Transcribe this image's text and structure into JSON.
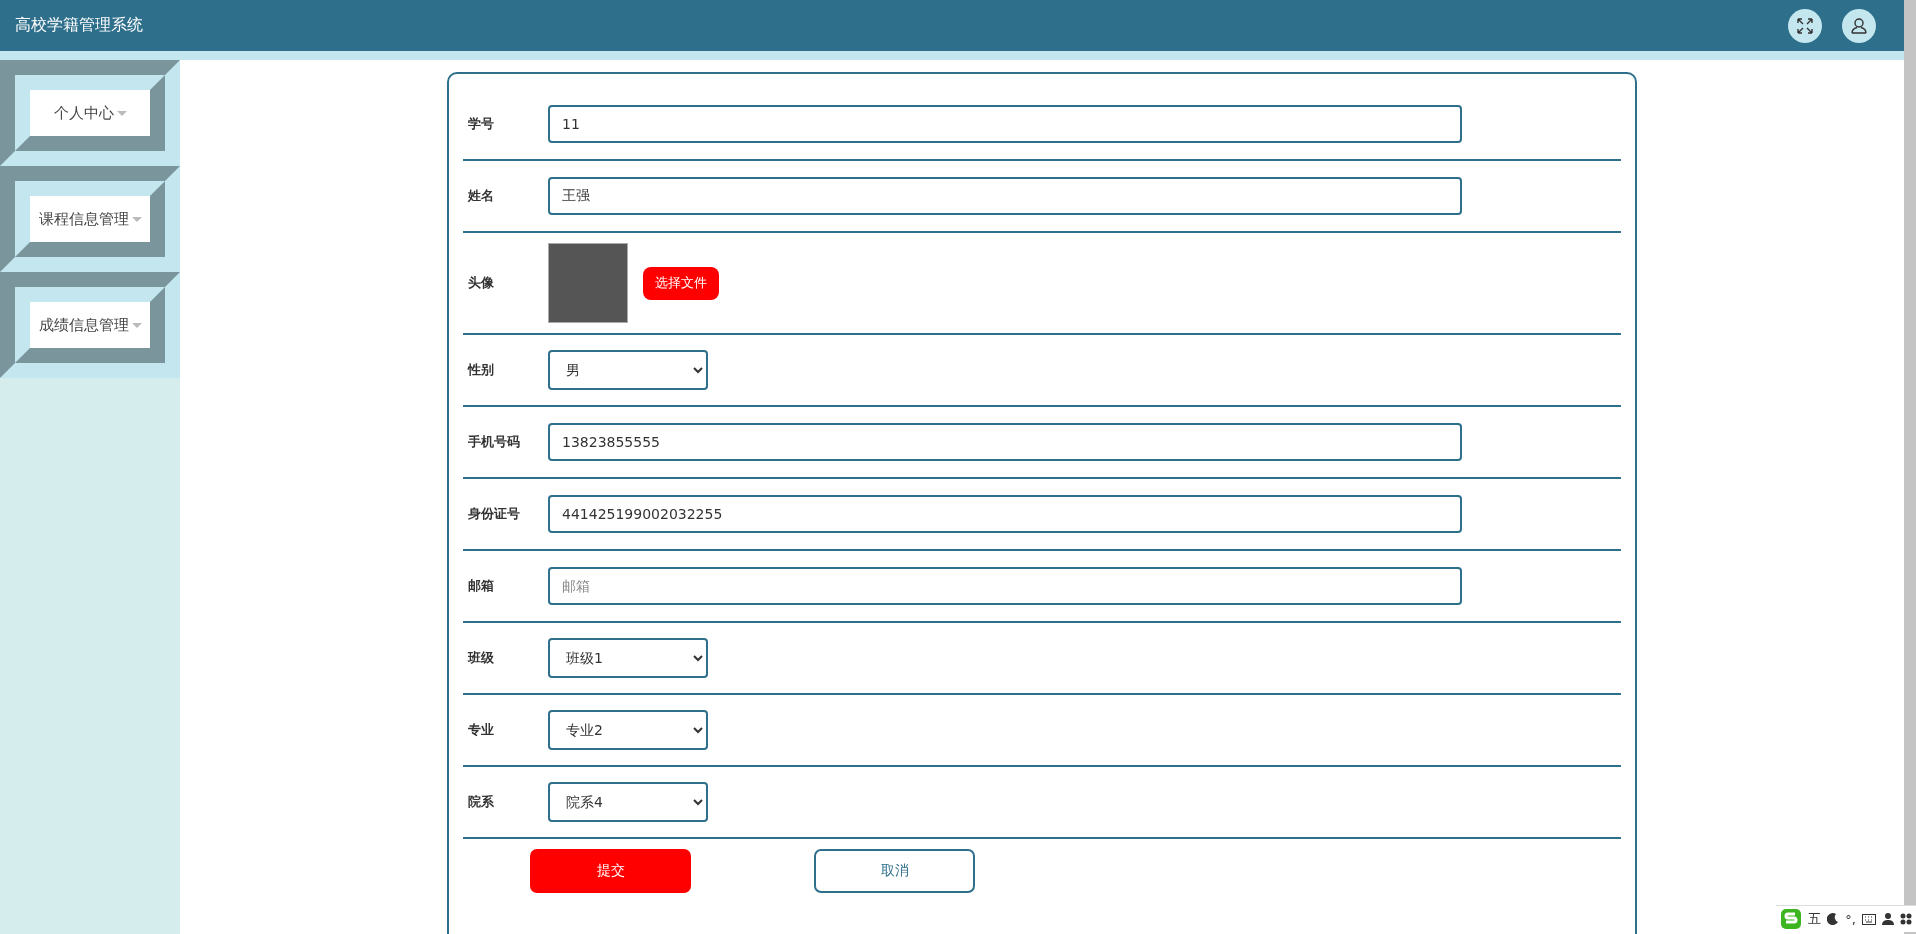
{
  "header": {
    "title": "高校学籍管理系统"
  },
  "sidebar": {
    "items": [
      {
        "label": "个人中心"
      },
      {
        "label": "课程信息管理"
      },
      {
        "label": "成绩信息管理"
      }
    ]
  },
  "form": {
    "fields": [
      {
        "kind": "text",
        "label": "学号",
        "value": "11"
      },
      {
        "kind": "text",
        "label": "姓名",
        "value": "王强"
      },
      {
        "kind": "image",
        "label": "头像",
        "button": "选择文件"
      },
      {
        "kind": "select",
        "label": "性别",
        "value": "男"
      },
      {
        "kind": "text",
        "label": "手机号码",
        "value": "13823855555"
      },
      {
        "kind": "text",
        "label": "身份证号",
        "value": "441425199002032255"
      },
      {
        "kind": "text",
        "label": "邮箱",
        "placeholder": "邮箱"
      },
      {
        "kind": "select",
        "label": "班级",
        "value": "班级1"
      },
      {
        "kind": "select",
        "label": "专业",
        "value": "专业2"
      },
      {
        "kind": "select",
        "label": "院系",
        "value": "院系4"
      }
    ],
    "submit": "提交",
    "cancel": "取消"
  },
  "ime_toolbar": {
    "mode": "五",
    "punct": "°,"
  }
}
